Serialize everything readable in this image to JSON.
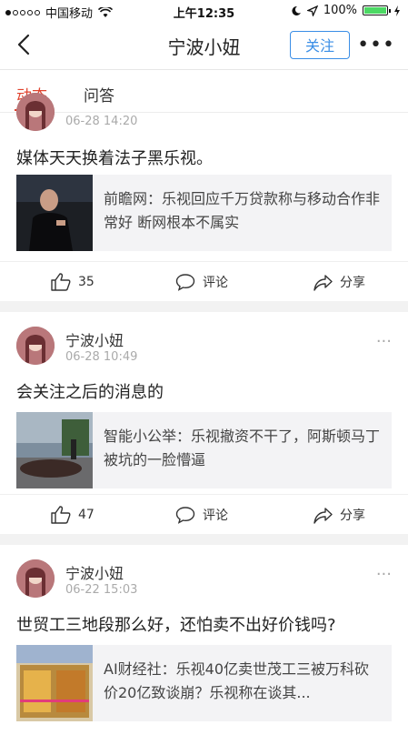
{
  "status": {
    "carrier": "中国移动",
    "time": "上午12:35",
    "battery": "100%"
  },
  "nav": {
    "title": "宁波小妞",
    "follow_label": "关注"
  },
  "tabs": [
    {
      "label": "动态"
    },
    {
      "label": "问答"
    }
  ],
  "posts": [
    {
      "time": "06-28 14:20",
      "text": "媒体天天换着法子黑乐视。",
      "card": {
        "title": "前瞻网：乐视回应千万贷款称与移动合作非常好 断网根本不属实"
      },
      "likes": "35",
      "comment_label": "评论",
      "share_label": "分享"
    },
    {
      "author": "宁波小妞",
      "time": "06-28 10:49",
      "text": "会关注之后的消息的",
      "card": {
        "title": "智能小公举：乐视撤资不干了，阿斯顿马丁被坑的一脸懵逼"
      },
      "likes": "47",
      "comment_label": "评论",
      "share_label": "分享"
    },
    {
      "author": "宁波小妞",
      "time": "06-22 15:03",
      "text": "世贸工三地段那么好，还怕卖不出好价钱吗?",
      "card": {
        "title": "AI财经社：乐视40亿卖世茂工三被万科砍价20亿致谈崩？乐视称在谈其..."
      }
    }
  ],
  "colors": {
    "accent": "#e0432e",
    "follow": "#3a8ee6"
  }
}
